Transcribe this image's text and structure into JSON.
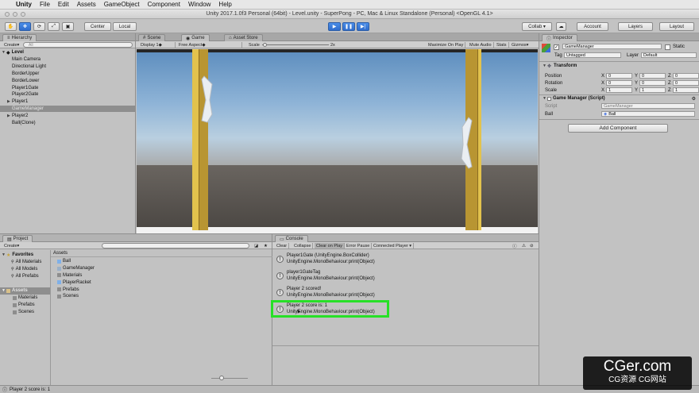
{
  "menubar": {
    "app": "Unity",
    "items": [
      "File",
      "Edit",
      "Assets",
      "GameObject",
      "Component",
      "Window",
      "Help"
    ]
  },
  "titlebar": {
    "title": "Unity 2017.1.0f3 Personal (64bit) - Level.unity - SuperPong - PC, Mac & Linux Standalone (Personal) <OpenGL 4.1>"
  },
  "toolbar": {
    "pivot": "Center",
    "space": "Local",
    "collab": "Collab ▾",
    "account": "Account",
    "layers": "Layers",
    "layout": "Layout"
  },
  "hierarchy": {
    "tab": "Hierarchy",
    "create": "Create",
    "search_placeholder": "All",
    "scene": "Level",
    "items": [
      {
        "label": "Main Camera",
        "indent": 1,
        "expand": false,
        "sel": false
      },
      {
        "label": "Directional Light",
        "indent": 1,
        "expand": false,
        "sel": false
      },
      {
        "label": "BorderUpper",
        "indent": 1,
        "expand": false,
        "sel": false
      },
      {
        "label": "BorderLower",
        "indent": 1,
        "expand": false,
        "sel": false
      },
      {
        "label": "Player1Gate",
        "indent": 1,
        "expand": false,
        "sel": false
      },
      {
        "label": "Player2Gate",
        "indent": 1,
        "expand": false,
        "sel": false
      },
      {
        "label": "Player1",
        "indent": 1,
        "expand": true,
        "sel": false
      },
      {
        "label": "GameManager",
        "indent": 1,
        "expand": false,
        "sel": true
      },
      {
        "label": "Player2",
        "indent": 1,
        "expand": true,
        "sel": false
      },
      {
        "label": "Ball(Clone)",
        "indent": 1,
        "expand": false,
        "sel": false
      }
    ]
  },
  "scene_tabs": [
    {
      "label": "Scene"
    },
    {
      "label": "Game"
    },
    {
      "label": "Asset Store"
    }
  ],
  "game": {
    "display": "Display 1",
    "aspect": "Free Aspect",
    "scale_label": "Scale",
    "scale_value": "2x",
    "maximize": "Maximize On Play",
    "mute": "Mute Audio",
    "stats": "Stats",
    "gizmos": "Gizmos"
  },
  "inspector": {
    "tab": "Inspector",
    "name": "GameManager",
    "static": "Static",
    "tag_label": "Tag",
    "tag": "Untagged",
    "layer_label": "Layer",
    "layer": "Default",
    "transform": "Transform",
    "rows": [
      {
        "label": "Position",
        "x": "0",
        "y": "0",
        "z": "0"
      },
      {
        "label": "Rotation",
        "x": "0",
        "y": "0",
        "z": "0"
      },
      {
        "label": "Scale",
        "x": "1",
        "y": "1",
        "z": "1"
      }
    ],
    "script_comp": "Game Manager (Script)",
    "script_label": "Script",
    "script_value": "GameManager",
    "ball_label": "Ball",
    "ball_value": "Ball",
    "add_component": "Add Component"
  },
  "project": {
    "tab": "Project",
    "create": "Create",
    "favorites": "Favorites",
    "fav_items": [
      "All Materials",
      "All Models",
      "All Prefabs"
    ],
    "assets_root": "Assets",
    "asset_folders": [
      "Materials",
      "Prefabs",
      "Scenes"
    ],
    "breadcrumb": "Assets",
    "assets": [
      {
        "label": "Ball",
        "kind": "cube"
      },
      {
        "label": "GameManager",
        "kind": "script"
      },
      {
        "label": "Materials",
        "kind": "folder"
      },
      {
        "label": "PlayerRacket",
        "kind": "cube"
      },
      {
        "label": "Prefabs",
        "kind": "folder"
      },
      {
        "label": "Scenes",
        "kind": "folder"
      }
    ]
  },
  "console": {
    "tab": "Console",
    "buttons": [
      "Clear",
      "Collapse",
      "Clear on Play",
      "Error Pause",
      "Connected Player ▾"
    ],
    "logs": [
      {
        "l1": "Player1Gate (UnityEngine.BoxCollider)",
        "l2": "UnityEngine.MonoBehaviour:print(Object)"
      },
      {
        "l1": "player1GateTag",
        "l2": "UnityEngine.MonoBehaviour:print(Object)"
      },
      {
        "l1": "Player 2 scored!",
        "l2": "UnityEngine.MonoBehaviour:print(Object)"
      },
      {
        "l1": "Player 2 score is: 1",
        "l2": "UnityEngine.MonoBehaviour:print(Object)"
      }
    ]
  },
  "statusbar": {
    "text": "Player 2 score is: 1"
  },
  "watermark": {
    "brand": "CGer.com",
    "sub": "CG资源  CG网站"
  },
  "colors": {
    "highlight": "#27e027",
    "gate": "#c9a53a",
    "selection": "#8e8e8e"
  }
}
